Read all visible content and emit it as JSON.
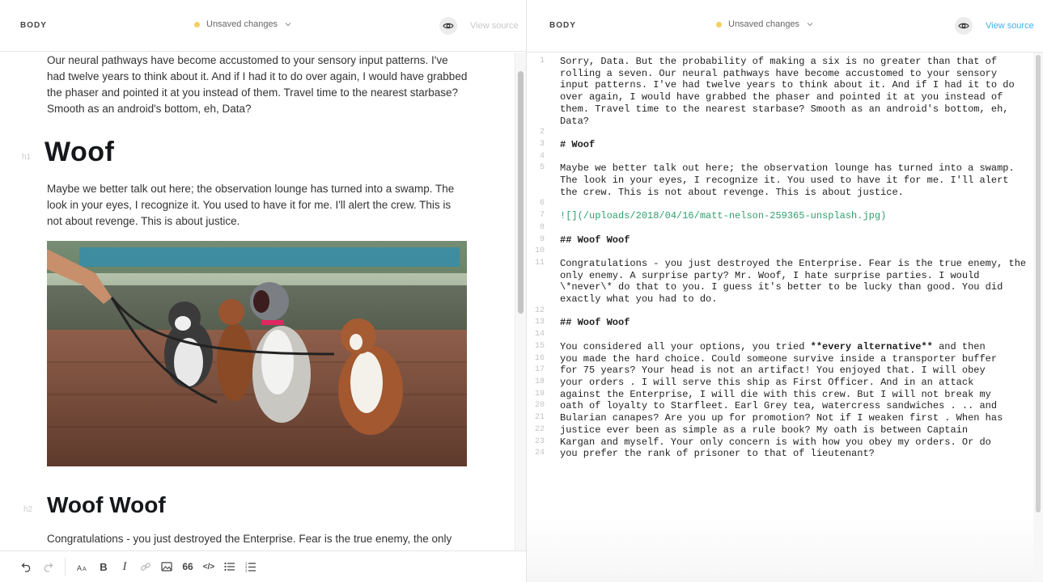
{
  "left_header": {
    "section_label": "BODY",
    "status": "Unsaved changes",
    "view_source": "View source"
  },
  "preview": {
    "intro_paragraph": "Our neural pathways have become accustomed to your sensory input patterns. I've had twelve years to think about it. And if I had it to do over again, I would have grabbed the phaser and pointed it at you instead of them. Travel time to the nearest starbase? Smooth as an android's bottom, eh, Data?",
    "h1_marker": "h1",
    "h1": "Woof",
    "paragraph_2": "Maybe we better talk out here; the observation lounge has turned into a swamp. The look in your eyes, I recognize it. You used to have it for me. I'll alert the crew. This is not about revenge. This is about justice.",
    "h2_marker": "h2",
    "h2": "Woof Woof",
    "paragraph_3": "Congratulations - you just destroyed the Enterprise. Fear is the true enemy, the only"
  },
  "toolbar": {
    "items": [
      "undo-icon",
      "redo-icon",
      "text-size-icon",
      "bold-icon",
      "italic-icon",
      "link-icon",
      "image-icon",
      "quote-icon",
      "code-icon",
      "bulleted-list-icon",
      "numbered-list-icon"
    ],
    "bold": "B",
    "italic": "I",
    "quote": "66",
    "code": "</>"
  },
  "right_header": {
    "section_label": "BODY",
    "status": "Unsaved changes",
    "view_source": "View source"
  },
  "colors": {
    "accent": "#3eb0ef",
    "status_dot": "#f4cf63",
    "link_green": "#2f9f6f"
  },
  "source": {
    "lines": [
      {
        "n": "1",
        "t": "Sorry, Data. But the probability of making a six is no greater than that of rolling a seven. Our neural pathways have become accustomed to your sensory input patterns. I've had twelve years to think about it. And if I had it to do over again, I would have grabbed the phaser and pointed it at you instead of them. Travel time to the nearest starbase? Smooth as an android's bottom, eh, Data?"
      },
      {
        "n": "2",
        "t": ""
      },
      {
        "n": "3",
        "t": "# Woof"
      },
      {
        "n": "4",
        "t": ""
      },
      {
        "n": "5",
        "t": "Maybe we better talk out here; the observation lounge has turned into a swamp. The look in your eyes, I recognize it. You used to have it for me. I'll alert the crew. This is not about revenge. This is about justice."
      },
      {
        "n": "6",
        "t": ""
      },
      {
        "n": "7",
        "t": "![](/uploads/2018/04/16/matt-nelson-259365-unsplash.jpg)"
      },
      {
        "n": "8",
        "t": ""
      },
      {
        "n": "9",
        "t": "## Woof Woof"
      },
      {
        "n": "10",
        "t": ""
      },
      {
        "n": "11",
        "t": "Congratulations - you just destroyed the Enterprise. Fear is the true enemy, the only enemy. A surprise party? Mr. Woof, I hate surprise parties. I would \\*never\\* do that to you. I guess it's better to be lucky than good. You did exactly what you had to do."
      },
      {
        "n": "12",
        "t": ""
      },
      {
        "n": "13",
        "t": "## Woof Woof"
      },
      {
        "n": "14",
        "t": ""
      },
      {
        "n": "15",
        "t": "You considered all your options, you tried **every alternative** and then"
      },
      {
        "n": "16",
        "t": "you made the hard choice. Could someone survive inside a transporter buffer"
      },
      {
        "n": "17",
        "t": "for 75 years? Your head is not an artifact! You enjoyed that. I will obey"
      },
      {
        "n": "18",
        "t": "your orders . I will serve this ship as First Officer. And in an attack"
      },
      {
        "n": "19",
        "t": "against the Enterprise, I will die with this crew. But I will not break my"
      },
      {
        "n": "20",
        "t": "oath of loyalty to Starfleet. Earl Grey tea, watercress sandwiches . .. and"
      },
      {
        "n": "21",
        "t": "Bularian canapes? Are you up for promotion? Not if I weaken first . When has"
      },
      {
        "n": "22",
        "t": "justice ever been as simple as a rule book? My oath is between Captain"
      },
      {
        "n": "23",
        "t": "Kargan and myself. Your only concern is with how you obey my orders. Or do"
      },
      {
        "n": "24",
        "t": "you prefer the rank of prisoner to that of lieutenant?"
      }
    ]
  }
}
